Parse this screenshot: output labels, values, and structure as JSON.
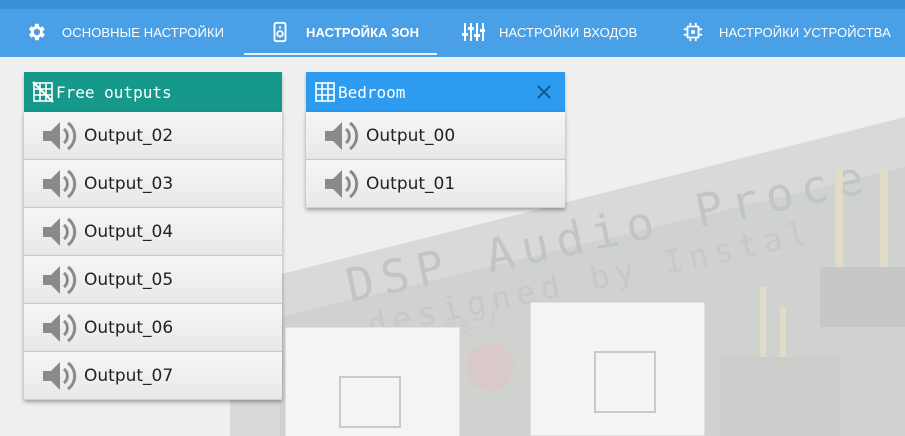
{
  "tabs": [
    {
      "label": "ОСНОВНЫЕ НАСТРОЙКИ",
      "icon": "gear-icon"
    },
    {
      "label": "НАСТРОЙКА ЗОН",
      "icon": "speaker-icon"
    },
    {
      "label": "НАСТРОЙКИ ВХОДОВ",
      "icon": "equalizer-icon"
    },
    {
      "label": "НАСТРОЙКИ УСТРОЙСТВА",
      "icon": "chip-icon"
    }
  ],
  "active_tab": "НАСТРОЙКА ЗОН",
  "zones": [
    {
      "title": "Free outputs",
      "header_color": "#16998a",
      "icon": "no-grid-icon",
      "items": [
        "Output_02",
        "Output_03",
        "Output_04",
        "Output_05",
        "Output_06",
        "Output_07"
      ]
    },
    {
      "title": "Bedroom",
      "header_color": "#2d9bf0",
      "icon": "grid-icon",
      "close_icon": "close-icon",
      "items": [
        "Output_00",
        "Output_01"
      ]
    }
  ],
  "background": {
    "text_line1": "DSP Audio Proce",
    "text_line2": "designed by Instal",
    "text_line3": "ps:/"
  },
  "colors": {
    "topbar": "#4aa0e6",
    "free_header": "#16998a",
    "zone_header": "#2d9bf0"
  }
}
